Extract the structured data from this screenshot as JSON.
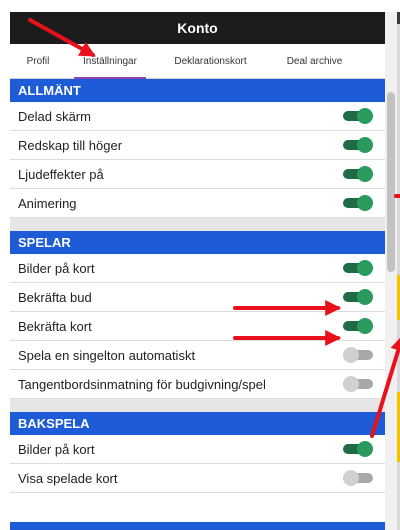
{
  "header": {
    "title": "Konto"
  },
  "tabs": [
    {
      "label": "Profil",
      "active": false
    },
    {
      "label": "Inställningar",
      "active": true
    },
    {
      "label": "Deklarationskort",
      "active": false
    },
    {
      "label": "Deal archive",
      "active": false
    }
  ],
  "sections": [
    {
      "title": "ALLMÄNT",
      "items": [
        {
          "label": "Delad skärm",
          "on": true
        },
        {
          "label": "Redskap till höger",
          "on": true
        },
        {
          "label": "Ljudeffekter på",
          "on": true
        },
        {
          "label": "Animering",
          "on": true
        }
      ]
    },
    {
      "title": "SPELAR",
      "items": [
        {
          "label": "Bilder på kort",
          "on": true
        },
        {
          "label": "Bekräfta bud",
          "on": true
        },
        {
          "label": "Bekräfta kort",
          "on": true
        },
        {
          "label": "Spela en singelton automatiskt",
          "on": false
        },
        {
          "label": "Tangentbordsinmatning för budgivning/spel",
          "on": false
        }
      ]
    },
    {
      "title": "BAKSPELA",
      "items": [
        {
          "label": "Bilder på kort",
          "on": true
        },
        {
          "label": "Visa spelade kort",
          "on": false
        }
      ]
    }
  ],
  "colors": {
    "header_bg": "#1c1c1c",
    "section_bg": "#1e5bd6",
    "toggle_on": "#2b9b5d",
    "toggle_off": "#d0d0d0",
    "annotation": "#e8101a",
    "tab_underline": "#8e44ad"
  }
}
